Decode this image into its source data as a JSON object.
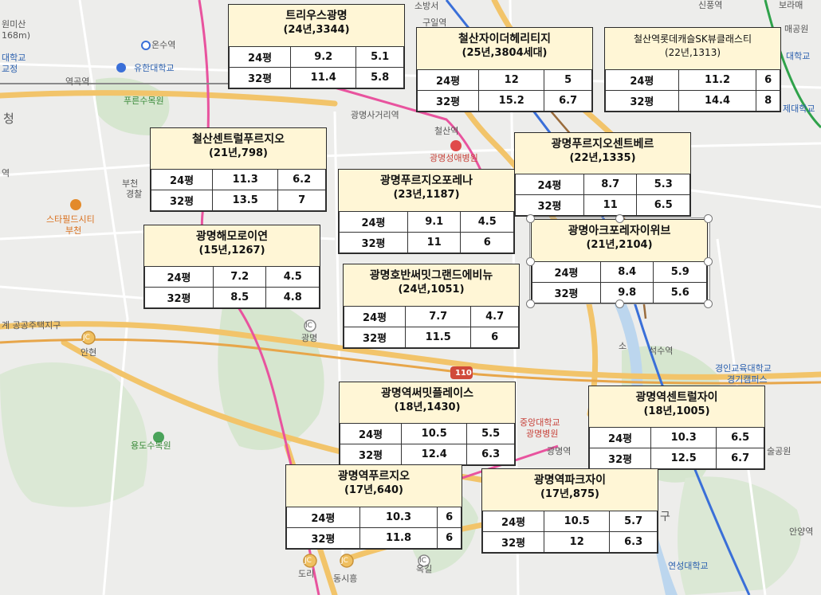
{
  "colors": {
    "card_bg": "#fff6d6",
    "road_yellow": "#f2c46a",
    "rail_pink": "#e8539e",
    "rail_blue": "#3a6fd8",
    "park_green": "#cfe3c7"
  },
  "map_labels": [
    {
      "id": "l1",
      "text": "원미산"
    },
    {
      "id": "l2",
      "text": "168m)"
    },
    {
      "id": "l3",
      "text": "대학교"
    },
    {
      "id": "l4",
      "text": "교정"
    },
    {
      "id": "l5",
      "text": "온수역"
    },
    {
      "id": "l6",
      "text": "유한대학교"
    },
    {
      "id": "l7",
      "text": "역곡역"
    },
    {
      "id": "l8",
      "text": "푸른수목원"
    },
    {
      "id": "l9",
      "text": "청"
    },
    {
      "id": "l10",
      "text": "역"
    },
    {
      "id": "l11",
      "text": "부천"
    },
    {
      "id": "l12",
      "text": "경찰"
    },
    {
      "id": "l13",
      "text": "스타필드시티"
    },
    {
      "id": "l14",
      "text": "부천"
    },
    {
      "id": "l15",
      "text": "계 공공주택지구"
    },
    {
      "id": "l16",
      "text": "안현"
    },
    {
      "id": "l17",
      "text": "용도수목원"
    },
    {
      "id": "l18",
      "text": "광명"
    },
    {
      "id": "l19",
      "text": "광명사거리역"
    },
    {
      "id": "l20",
      "text": "철산역"
    },
    {
      "id": "l21",
      "text": "광명성애병원"
    },
    {
      "id": "l22",
      "text": "구일역"
    },
    {
      "id": "l23",
      "text": "소방서"
    },
    {
      "id": "l24",
      "text": "신풍역"
    },
    {
      "id": "l25",
      "text": "보라매"
    },
    {
      "id": "l26",
      "text": "매공원"
    },
    {
      "id": "l27",
      "text": "대학교"
    },
    {
      "id": "l28",
      "text": "제대학교"
    },
    {
      "id": "l29",
      "text": "석수역"
    },
    {
      "id": "l30",
      "text": "경인교육대학교"
    },
    {
      "id": "l31",
      "text": "경기캠퍼스"
    },
    {
      "id": "l32",
      "text": "소"
    },
    {
      "id": "l33",
      "text": "중앙대학교"
    },
    {
      "id": "l34",
      "text": "광명병원"
    },
    {
      "id": "l35",
      "text": "광명역"
    },
    {
      "id": "l36",
      "text": "술공원"
    },
    {
      "id": "l37",
      "text": "구"
    },
    {
      "id": "l38",
      "text": "안양역"
    },
    {
      "id": "l39",
      "text": "연성대학교"
    },
    {
      "id": "l40",
      "text": "도리"
    },
    {
      "id": "l41",
      "text": "동시흥"
    },
    {
      "id": "l42",
      "text": "옥길"
    },
    {
      "id": "l43",
      "text": "110"
    },
    {
      "id": "l44",
      "text": "JC"
    },
    {
      "id": "l45",
      "text": "JC"
    },
    {
      "id": "l46",
      "text": "JC"
    },
    {
      "id": "l47",
      "text": "IC"
    },
    {
      "id": "l48",
      "text": "IC"
    }
  ],
  "cards": [
    {
      "name": "트리우스광명",
      "meta": "(24년,3344)",
      "rows": [
        [
          "24평",
          "9.2",
          "5.1"
        ],
        [
          "32평",
          "11.4",
          "5.8"
        ]
      ]
    },
    {
      "name": "철산자이더헤리티지",
      "meta": "(25년,3804세대)",
      "rows": [
        [
          "24평",
          "12",
          "5"
        ],
        [
          "32평",
          "15.2",
          "6.7"
        ]
      ]
    },
    {
      "name": "철산역롯데캐슬SK뷰클래스티",
      "meta": "(22년,1313)",
      "rows": [
        [
          "24평",
          "11.2",
          "6"
        ],
        [
          "32평",
          "14.4",
          "8"
        ]
      ]
    },
    {
      "name": "철산센트럴푸르지오",
      "meta": "(21년,798)",
      "rows": [
        [
          "24평",
          "11.3",
          "6.2"
        ],
        [
          "32평",
          "13.5",
          "7"
        ]
      ]
    },
    {
      "name": "광명푸르지오센트베르",
      "meta": "(22년,1335)",
      "rows": [
        [
          "24평",
          "8.7",
          "5.3"
        ],
        [
          "32평",
          "11",
          "6.5"
        ]
      ]
    },
    {
      "name": "광명푸르지오포레나",
      "meta": "(23년,1187)",
      "rows": [
        [
          "24평",
          "9.1",
          "4.5"
        ],
        [
          "32평",
          "11",
          "6"
        ]
      ]
    },
    {
      "name": "광명아크포레자이위브",
      "meta": "(21년,2104)",
      "rows": [
        [
          "24평",
          "8.4",
          "5.9"
        ],
        [
          "32평",
          "9.8",
          "5.6"
        ]
      ]
    },
    {
      "name": "광명해모로이연",
      "meta": "(15년,1267)",
      "rows": [
        [
          "24평",
          "7.2",
          "4.5"
        ],
        [
          "32평",
          "8.5",
          "4.8"
        ]
      ]
    },
    {
      "name": "광명호반써밋그랜드에비뉴",
      "meta": "(24년,1051)",
      "rows": [
        [
          "24평",
          "7.7",
          "4.7"
        ],
        [
          "32평",
          "11.5",
          "6"
        ]
      ]
    },
    {
      "name": "광명역써밋플레이스",
      "meta": "(18년,1430)",
      "rows": [
        [
          "24평",
          "10.5",
          "5.5"
        ],
        [
          "32평",
          "12.4",
          "6.3"
        ]
      ]
    },
    {
      "name": "광명역센트럴자이",
      "meta": "(18년,1005)",
      "rows": [
        [
          "24평",
          "10.3",
          "6.5"
        ],
        [
          "32평",
          "12.5",
          "6.7"
        ]
      ]
    },
    {
      "name": "광명역푸르지오",
      "meta": "(17년,640)",
      "rows": [
        [
          "24평",
          "10.3",
          "6"
        ],
        [
          "32평",
          "11.8",
          "6"
        ]
      ]
    },
    {
      "name": "광명역파크자이",
      "meta": "(17년,875)",
      "rows": [
        [
          "24평",
          "10.5",
          "5.7"
        ],
        [
          "32평",
          "12",
          "6.3"
        ]
      ]
    }
  ]
}
